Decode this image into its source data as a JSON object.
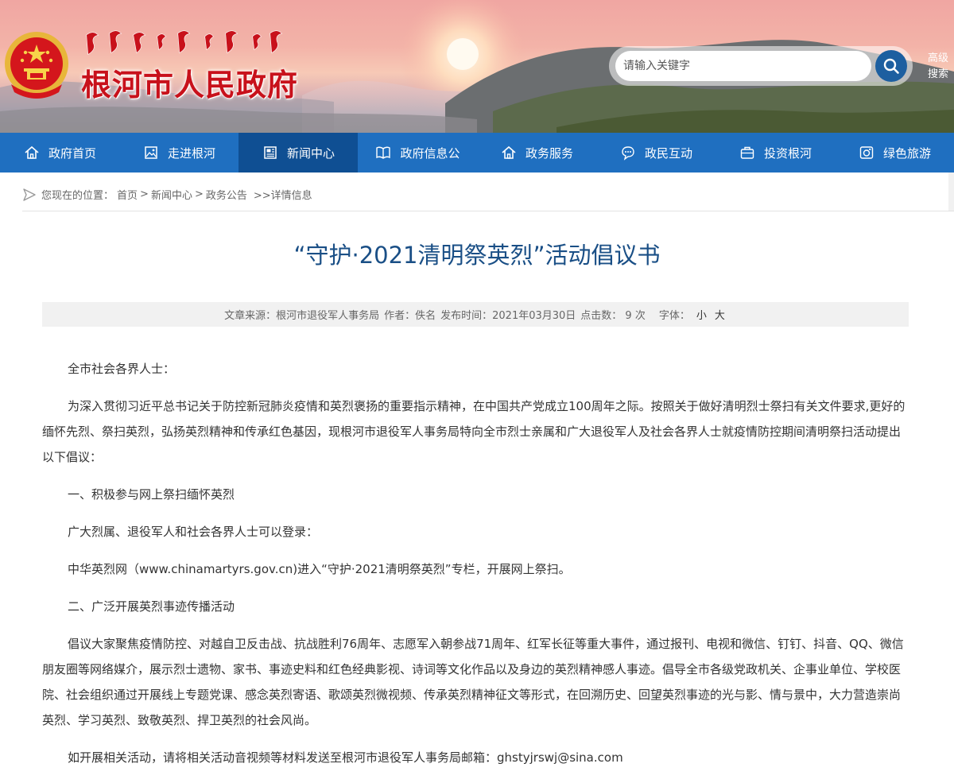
{
  "header": {
    "site_title": "根河市人民政府",
    "search_placeholder": "请输入关键字",
    "advanced_search_label": "高级搜索"
  },
  "nav": {
    "items": [
      {
        "label": "政府首页",
        "icon": "home-icon",
        "active": false
      },
      {
        "label": "走进根河",
        "icon": "image-icon",
        "active": false
      },
      {
        "label": "新闻中心",
        "icon": "newspaper-icon",
        "active": true
      },
      {
        "label": "政府信息公",
        "icon": "book-icon",
        "active": false
      },
      {
        "label": "政务服务",
        "icon": "home-icon",
        "active": false
      },
      {
        "label": "政民互动",
        "icon": "chat-icon",
        "active": false
      },
      {
        "label": "投资根河",
        "icon": "briefcase-icon",
        "active": false
      },
      {
        "label": "绿色旅游",
        "icon": "camera-icon",
        "active": false
      }
    ]
  },
  "breadcrumb": {
    "prefix": "您现在的位置：",
    "home": "首页",
    "news": "新闻中心",
    "notice": "政务公告",
    "current": ">>详情信息"
  },
  "article": {
    "title": "“守护·2021清明祭英烈”活动倡议书",
    "meta": {
      "source": "文章来源：根河市退役军人事务局",
      "author": "作者：佚名",
      "time": "发布时间：2021年03月30日",
      "clicks": "点击数： 9 次",
      "font_label": "字体：",
      "font_small": "小",
      "font_large": "大"
    },
    "paragraphs": [
      "全市社会各界人士：",
      "为深入贯彻习近平总书记关于防控新冠肺炎疫情和英烈褒扬的重要指示精神，在中国共产党成立100周年之际。按照关于做好清明烈士祭扫有关文件要求,更好的缅怀先烈、祭扫英烈，弘扬英烈精神和传承红色基因，现根河市退役军人事务局特向全市烈士亲属和广大退役军人及社会各界人士就疫情防控期间清明祭扫活动提出以下倡议：",
      "一、积极参与网上祭扫缅怀英烈",
      "广大烈属、退役军人和社会各界人士可以登录：",
      "中华英烈网（www.chinamartyrs.gov.cn)进入“守护·2021清明祭英烈”专栏，开展网上祭扫。",
      "二、广泛开展英烈事迹传播活动",
      "倡议大家聚焦疫情防控、对越自卫反击战、抗战胜利76周年、志愿军入朝参战71周年、红军长征等重大事件，通过报刊、电视和微信、钉钉、抖音、QQ、微信朋友圈等网络媒介，展示烈士遗物、家书、事迹史料和红色经典影视、诗词等文化作品以及身边的英烈精神感人事迹。倡导全市各级党政机关、企事业单位、学校医院、社会组织通过开展线上专题党课、感念英烈寄语、歌颂英烈微视频、传承英烈精神征文等形式，在回溯历史、回望英烈事迹的光与影、情与景中，大力营造崇尚英烈、学习英烈、致敬英烈、捍卫英烈的社会风尚。",
      "如开展相关活动，请将相关活动音视频等材料发送至根河市退役军人事务局邮箱：ghstyjrswj@sina.com"
    ]
  },
  "colors": {
    "nav_bg": "#1f6fc0",
    "nav_active": "#0f4f93",
    "title_color": "#1a4f86",
    "site_title_color": "#c8111b",
    "search_button": "#1d5fa0"
  }
}
